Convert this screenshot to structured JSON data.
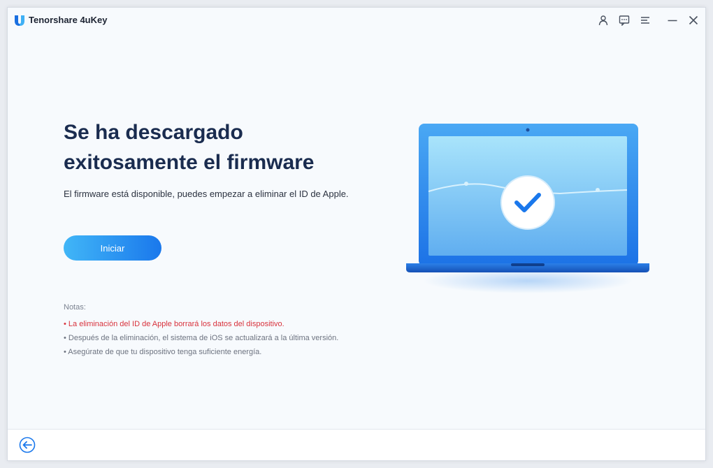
{
  "app": {
    "title": "Tenorshare 4uKey"
  },
  "titlebar": {
    "icons": [
      "account-icon",
      "feedback-icon",
      "menu-icon",
      "minimize-icon",
      "close-icon"
    ]
  },
  "main": {
    "title_line1": "Se ha descargado",
    "title_line2": "exitosamente el firmware",
    "subtitle": "El firmware está disponible, puedes empezar a eliminar el ID de Apple.",
    "start_button": "Iniciar"
  },
  "notes": {
    "title": "Notas:",
    "items": [
      "• La eliminación del ID de Apple borrará los datos del dispositivo.",
      "• Después de la eliminación, el sistema de iOS se actualizará a la última versión.",
      "• Asegúrate de que tu dispositivo tenga suficiente energía."
    ]
  },
  "illustration": {
    "icon": "laptop-check-icon"
  },
  "footer": {
    "back_icon": "back-arrow-icon"
  },
  "colors": {
    "accent": "#1a78ec",
    "title": "#1a2c4f",
    "warning": "#d8323c",
    "note": "#6d7380"
  }
}
